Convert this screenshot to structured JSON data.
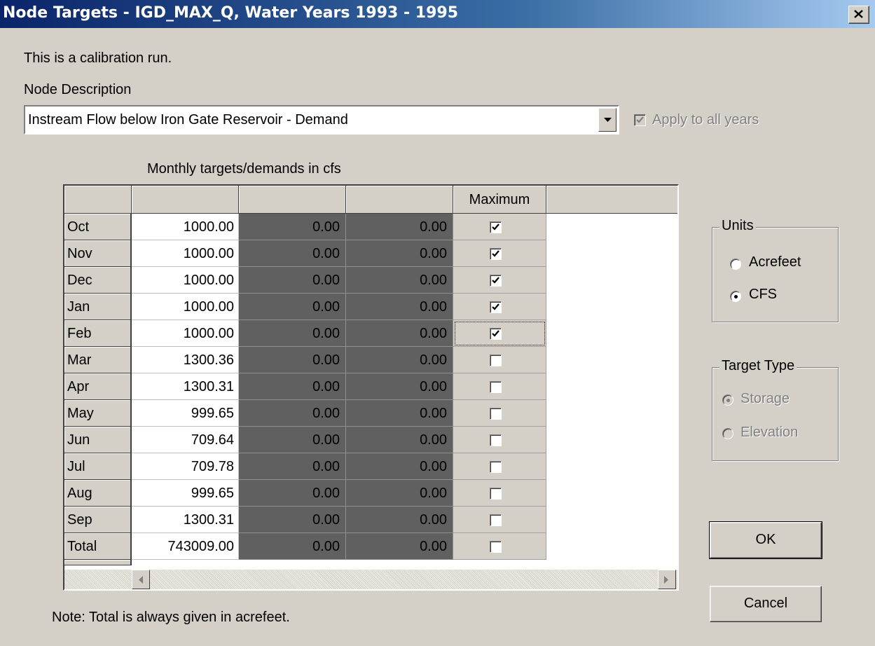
{
  "window": {
    "title": "Node Targets - IGD_MAX_Q, Water Years 1993 - 1995",
    "close_glyph": "×"
  },
  "info": {
    "calibration_text": "This is a calibration run.",
    "node_description_label": "Node Description",
    "node_description_value": "Instream Flow below Iron Gate Reservoir - Demand",
    "apply_all_years_label": "Apply to all years",
    "apply_all_years_checked": true
  },
  "table": {
    "caption": "Monthly targets/demands in cfs",
    "columns": [
      "",
      "",
      "",
      "Maximum"
    ],
    "rows": [
      {
        "label": "Oct",
        "v1": "1000.00",
        "v2": "0.00",
        "v3": "0.00",
        "max": true
      },
      {
        "label": "Nov",
        "v1": "1000.00",
        "v2": "0.00",
        "v3": "0.00",
        "max": true
      },
      {
        "label": "Dec",
        "v1": "1000.00",
        "v2": "0.00",
        "v3": "0.00",
        "max": true
      },
      {
        "label": "Jan",
        "v1": "1000.00",
        "v2": "0.00",
        "v3": "0.00",
        "max": true
      },
      {
        "label": "Feb",
        "v1": "1000.00",
        "v2": "0.00",
        "v3": "0.00",
        "max": true
      },
      {
        "label": "Mar",
        "v1": "1300.36",
        "v2": "0.00",
        "v3": "0.00",
        "max": false
      },
      {
        "label": "Apr",
        "v1": "1300.31",
        "v2": "0.00",
        "v3": "0.00",
        "max": false
      },
      {
        "label": "May",
        "v1": "999.65",
        "v2": "0.00",
        "v3": "0.00",
        "max": false
      },
      {
        "label": "Jun",
        "v1": "709.64",
        "v2": "0.00",
        "v3": "0.00",
        "max": false
      },
      {
        "label": "Jul",
        "v1": "709.78",
        "v2": "0.00",
        "v3": "0.00",
        "max": false
      },
      {
        "label": "Aug",
        "v1": "999.65",
        "v2": "0.00",
        "v3": "0.00",
        "max": false
      },
      {
        "label": "Sep",
        "v1": "1300.31",
        "v2": "0.00",
        "v3": "0.00",
        "max": false
      },
      {
        "label": "Total",
        "v1": "743009.00",
        "v2": "0.00",
        "v3": "0.00",
        "max": false
      }
    ]
  },
  "units": {
    "title": "Units",
    "options": [
      "Acrefeet",
      "CFS"
    ],
    "selected": "CFS"
  },
  "target_type": {
    "title": "Target Type",
    "options": [
      "Storage",
      "Elevation"
    ],
    "selected": "Storage",
    "enabled": false
  },
  "buttons": {
    "ok": "OK",
    "cancel": "Cancel"
  },
  "note": "Note:  Total is always given in acrefeet."
}
